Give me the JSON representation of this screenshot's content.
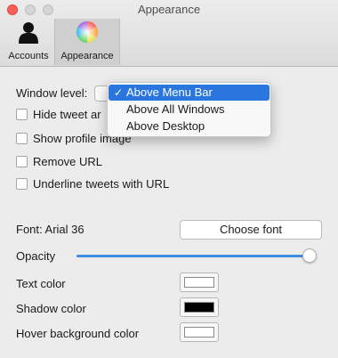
{
  "window": {
    "title": "Appearance"
  },
  "toolbar": {
    "items": [
      {
        "label": "Accounts",
        "icon": "person-icon"
      },
      {
        "label": "Appearance",
        "icon": "color-wheel-icon",
        "selected": true
      }
    ]
  },
  "window_level": {
    "label": "Window level:",
    "options": [
      "Above Menu Bar",
      "Above All Windows",
      "Above Desktop"
    ],
    "selected": "Above Menu Bar",
    "check_glyph": "✓"
  },
  "checkboxes": [
    {
      "label": "Hide tweet ar",
      "checked": false
    },
    {
      "label": "Show profile image",
      "checked": false
    },
    {
      "label": "Remove URL",
      "checked": false
    },
    {
      "label": "Underline tweets with URL",
      "checked": false
    }
  ],
  "font": {
    "label": "Font: Arial 36",
    "button_label": "Choose font"
  },
  "opacity": {
    "label": "Opacity",
    "value": 1.0
  },
  "colors": [
    {
      "label": "Text color",
      "value": "#ffffff"
    },
    {
      "label": "Shadow color",
      "value": "#000000"
    },
    {
      "label": "Hover background color",
      "value": "#ffffff"
    }
  ],
  "accent_color": "#2b76de"
}
